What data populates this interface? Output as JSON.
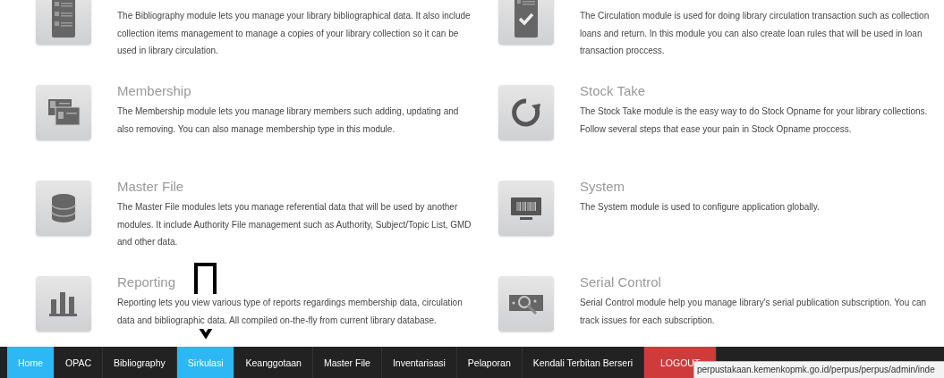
{
  "modules": [
    {
      "kind": "list",
      "description": "The Bibliography module lets you manage your library bibliographical data. It also include collection items management to manage a copies of your library collection so it can be used in library circulation."
    },
    {
      "kind": "checklist",
      "description": "The Circulation module is used for doing library circulation transaction such as collection loans and return. In this module you can also create loan rules that will be used in loan transaction proccess."
    },
    {
      "kind": "cards",
      "title": "Membership",
      "description": "The Membership module lets you manage library members such adding, updating and also removing. You can also manage membership type in this module."
    },
    {
      "kind": "refresh",
      "title": "Stock Take",
      "description": "The Stock Take module is the easy way to do Stock Opname for your library collections. Follow several steps that ease your pain in Stock Opname proccess."
    },
    {
      "kind": "database",
      "title": "Master File",
      "description": "The Master File modules lets you manage referential data that will be used by another modules. It include Authority File management such as Authority, Subject/Topic List, GMD and other data."
    },
    {
      "kind": "monitor",
      "title": "System",
      "description": "The System module is used to configure application globally."
    },
    {
      "kind": "chart",
      "title": "Reporting",
      "description": "Reporting lets you view various type of reports regardings membership data, circulation data and bibliographic data. All compiled on-the-fly from current library database."
    },
    {
      "kind": "serial",
      "title": "Serial Control",
      "description": "Serial Control module help you manage library's serial publication subscription. You can track issues for each subscription."
    }
  ],
  "nav": [
    {
      "label": "Home",
      "selected": true,
      "kind": "link"
    },
    {
      "label": "OPAC",
      "selected": false,
      "kind": "link"
    },
    {
      "label": "Bibliography",
      "selected": false,
      "kind": "link"
    },
    {
      "label": "Sirkulasi",
      "selected": true,
      "kind": "link"
    },
    {
      "label": "Keanggotaan",
      "selected": false,
      "kind": "link"
    },
    {
      "label": "Master File",
      "selected": false,
      "kind": "link"
    },
    {
      "label": "Inventarisasi",
      "selected": false,
      "kind": "link"
    },
    {
      "label": "Pelaporan",
      "selected": false,
      "kind": "link"
    },
    {
      "label": "Kendali Terbitan Berseri",
      "selected": false,
      "kind": "link"
    },
    {
      "label": "LOGOUT",
      "selected": false,
      "kind": "logout"
    }
  ],
  "status_url": "perpustakaan.kemenkopmk.go.id/perpus/perpus/admin/inde"
}
